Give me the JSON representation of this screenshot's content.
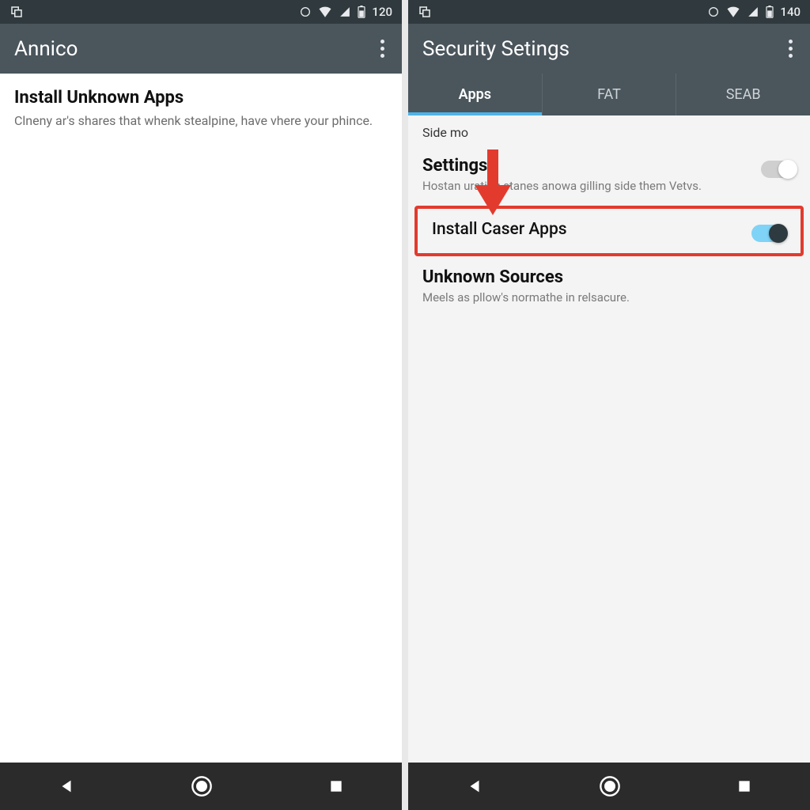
{
  "left": {
    "status": {
      "battery": "120"
    },
    "appbar": {
      "title": "Annico"
    },
    "section": {
      "title": "Install Unknown Apps",
      "desc": "Clneny ar's shares that whenk stealpine, have vhere your phince."
    }
  },
  "right": {
    "status": {
      "battery": "140"
    },
    "appbar": {
      "title": "Security Setings"
    },
    "tabs": [
      {
        "label": "Apps",
        "active": true
      },
      {
        "label": "FAT",
        "active": false
      },
      {
        "label": "SEAB",
        "active": false
      }
    ],
    "subheader": "Side mo",
    "rows": [
      {
        "title": "Settings",
        "desc": "Hostan urating stanes anowa gilling side them Vetvs.",
        "toggle": {
          "on": false
        }
      },
      {
        "title": "Install Caser Apps",
        "desc": "",
        "toggle": {
          "on": true
        },
        "highlighted": true
      },
      {
        "title": "Unknown Sources",
        "desc": "Meels as pllow's normathe in relsacure.",
        "toggle": null
      }
    ]
  },
  "colors": {
    "accent": "#4fb3e8",
    "highlight": "#e23b2e"
  }
}
